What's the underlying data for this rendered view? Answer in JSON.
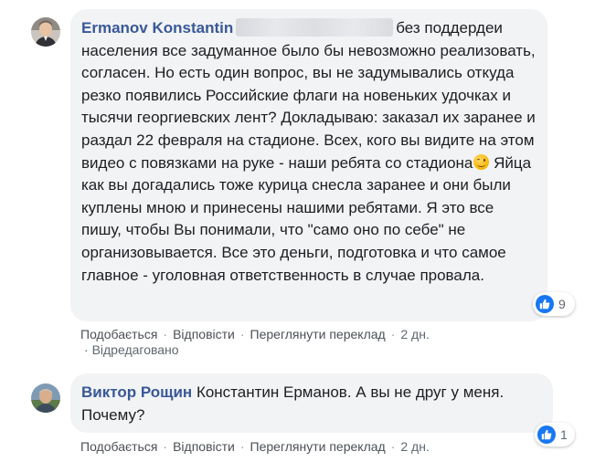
{
  "comments": [
    {
      "author": "Ermanov Konstantin",
      "text": "без поддердеи населения все задуманное было бы невозможно реализовать, согласен. Но есть один вопрос, вы не задумывались откуда резко появились Российские флаги на новеньких удочках и тысячи георгиевских лент? Докладываю: заказал их заранее и раздал 22 февраля на стадионе. Всех, кого вы видите на этом видео с повязками на руке - наши ребята со стадиона",
      "text_after_emoji": "Яйца как вы догадались тоже курица снесла заранее и они были куплены мною и принесены нашими ребятами. Я это все пишу, чтобы Вы понимали, что \"само оно по себе\" не организовывается. Все это деньги, подготовка и что самое главное - уголовная ответственность в случае провала.",
      "emoji": "winking-face",
      "reaction_count": "9",
      "actions": {
        "like": "Подобається",
        "reply": "Відповісти",
        "translate": "Переглянути переклад",
        "time": "2 дн."
      },
      "edited_label": "Відредаговано"
    },
    {
      "author": "Виктор Рощин",
      "text": "Константин Ерманов. А вы не друг у меня. Почему?",
      "reaction_count": "1",
      "actions": {
        "like": "Подобається",
        "reply": "Відповісти",
        "translate": "Переглянути переклад",
        "time": "2 дн."
      }
    }
  ],
  "colors": {
    "author": "#385898",
    "bubble": "#f2f3f5",
    "like": "#1877f2",
    "meta": "#606770"
  }
}
